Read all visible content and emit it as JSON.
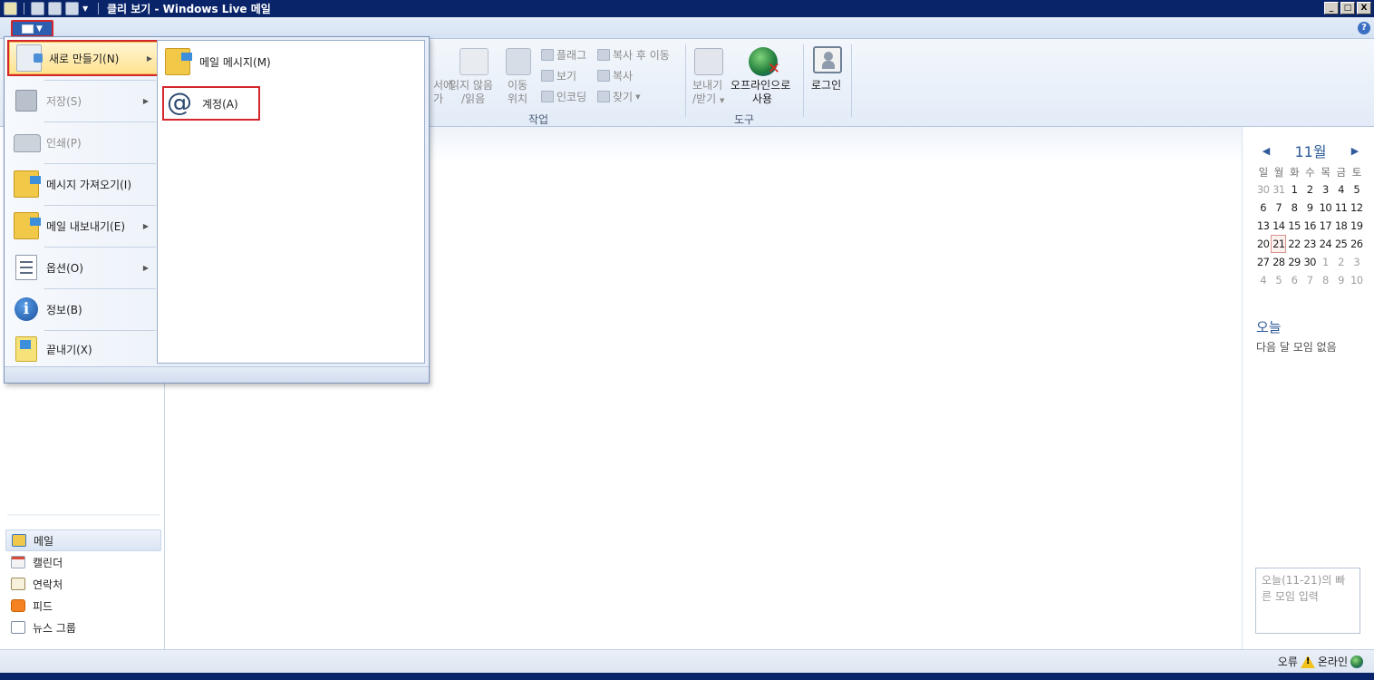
{
  "window": {
    "title": "클리 보기 - Windows Live 메일",
    "controls": [
      "_",
      "□",
      "X"
    ]
  },
  "ribbon": {
    "partial_button_1": "서에",
    "partial_button_1b": "가",
    "mark_unread": "읽지 않음",
    "mark_read": "/읽음",
    "move_1": "이동",
    "move_2": "위치",
    "flag": "플래그",
    "view": "보기",
    "encoding": "인코딩",
    "copy_and_move": "복사 후 이동",
    "copy": "복사",
    "find": "찾기",
    "group_actions": "작업",
    "send_receive_1": "보내기",
    "send_receive_2": "/받기",
    "work_offline_1": "오프라인으로",
    "work_offline_2": "사용",
    "group_tools": "도구",
    "login": "로그인"
  },
  "app_menu": {
    "items": [
      {
        "label": "새로 만들기(N)",
        "icon": "new-icon",
        "has_submenu": true,
        "disabled": false
      },
      {
        "label": "저장(S)",
        "icon": "save-icon",
        "has_submenu": true,
        "disabled": true
      },
      {
        "label": "인쇄(P)",
        "icon": "print-icon",
        "has_submenu": false,
        "disabled": true
      },
      {
        "label": "메시지 가져오기(I)",
        "icon": "import-icon",
        "has_submenu": false,
        "disabled": false
      },
      {
        "label": "메일 내보내기(E)",
        "icon": "export-icon",
        "has_submenu": true,
        "disabled": false
      },
      {
        "label": "옵션(O)",
        "icon": "options-icon",
        "has_submenu": true,
        "disabled": false
      },
      {
        "label": "정보(B)",
        "icon": "info-icon",
        "has_submenu": false,
        "disabled": false
      },
      {
        "label": "끝내기(X)",
        "icon": "exit-icon",
        "has_submenu": false,
        "disabled": false
      }
    ],
    "submenu": {
      "items": [
        {
          "label": "메일 메시지(M)",
          "icon": "mail-message-icon"
        },
        {
          "label": "계정(A)",
          "icon": "at-sign-icon"
        }
      ]
    }
  },
  "nav": {
    "items": [
      {
        "label": "메일",
        "icon": "mail-icon",
        "selected": true
      },
      {
        "label": "캘린더",
        "icon": "calendar-icon",
        "selected": false
      },
      {
        "label": "연락처",
        "icon": "contacts-icon",
        "selected": false
      },
      {
        "label": "피드",
        "icon": "feed-icon",
        "selected": false
      },
      {
        "label": "뉴스 그룹",
        "icon": "newsgroup-icon",
        "selected": false
      }
    ]
  },
  "calendar": {
    "month": "11월",
    "weekdays": [
      "일",
      "월",
      "화",
      "수",
      "목",
      "금",
      "토"
    ],
    "weeks": [
      [
        "30",
        "31",
        "1",
        "2",
        "3",
        "4",
        "5"
      ],
      [
        "6",
        "7",
        "8",
        "9",
        "10",
        "11",
        "12"
      ],
      [
        "13",
        "14",
        "15",
        "16",
        "17",
        "18",
        "19"
      ],
      [
        "20",
        "21",
        "22",
        "23",
        "24",
        "25",
        "26"
      ],
      [
        "27",
        "28",
        "29",
        "30",
        "1",
        "2",
        "3"
      ],
      [
        "4",
        "5",
        "6",
        "7",
        "8",
        "9",
        "10"
      ]
    ],
    "today": "21",
    "today_label": "오늘",
    "no_meetings": "다음 달 모임 없음",
    "quick_entry_placeholder": "오늘(11-21)의 빠른 모임 입력"
  },
  "status": {
    "error": "오류",
    "online": "온라인"
  },
  "colors": {
    "title_bar": "#0a246a",
    "highlight_border": "#d4262c",
    "accent_blue": "#2f5b9a"
  }
}
